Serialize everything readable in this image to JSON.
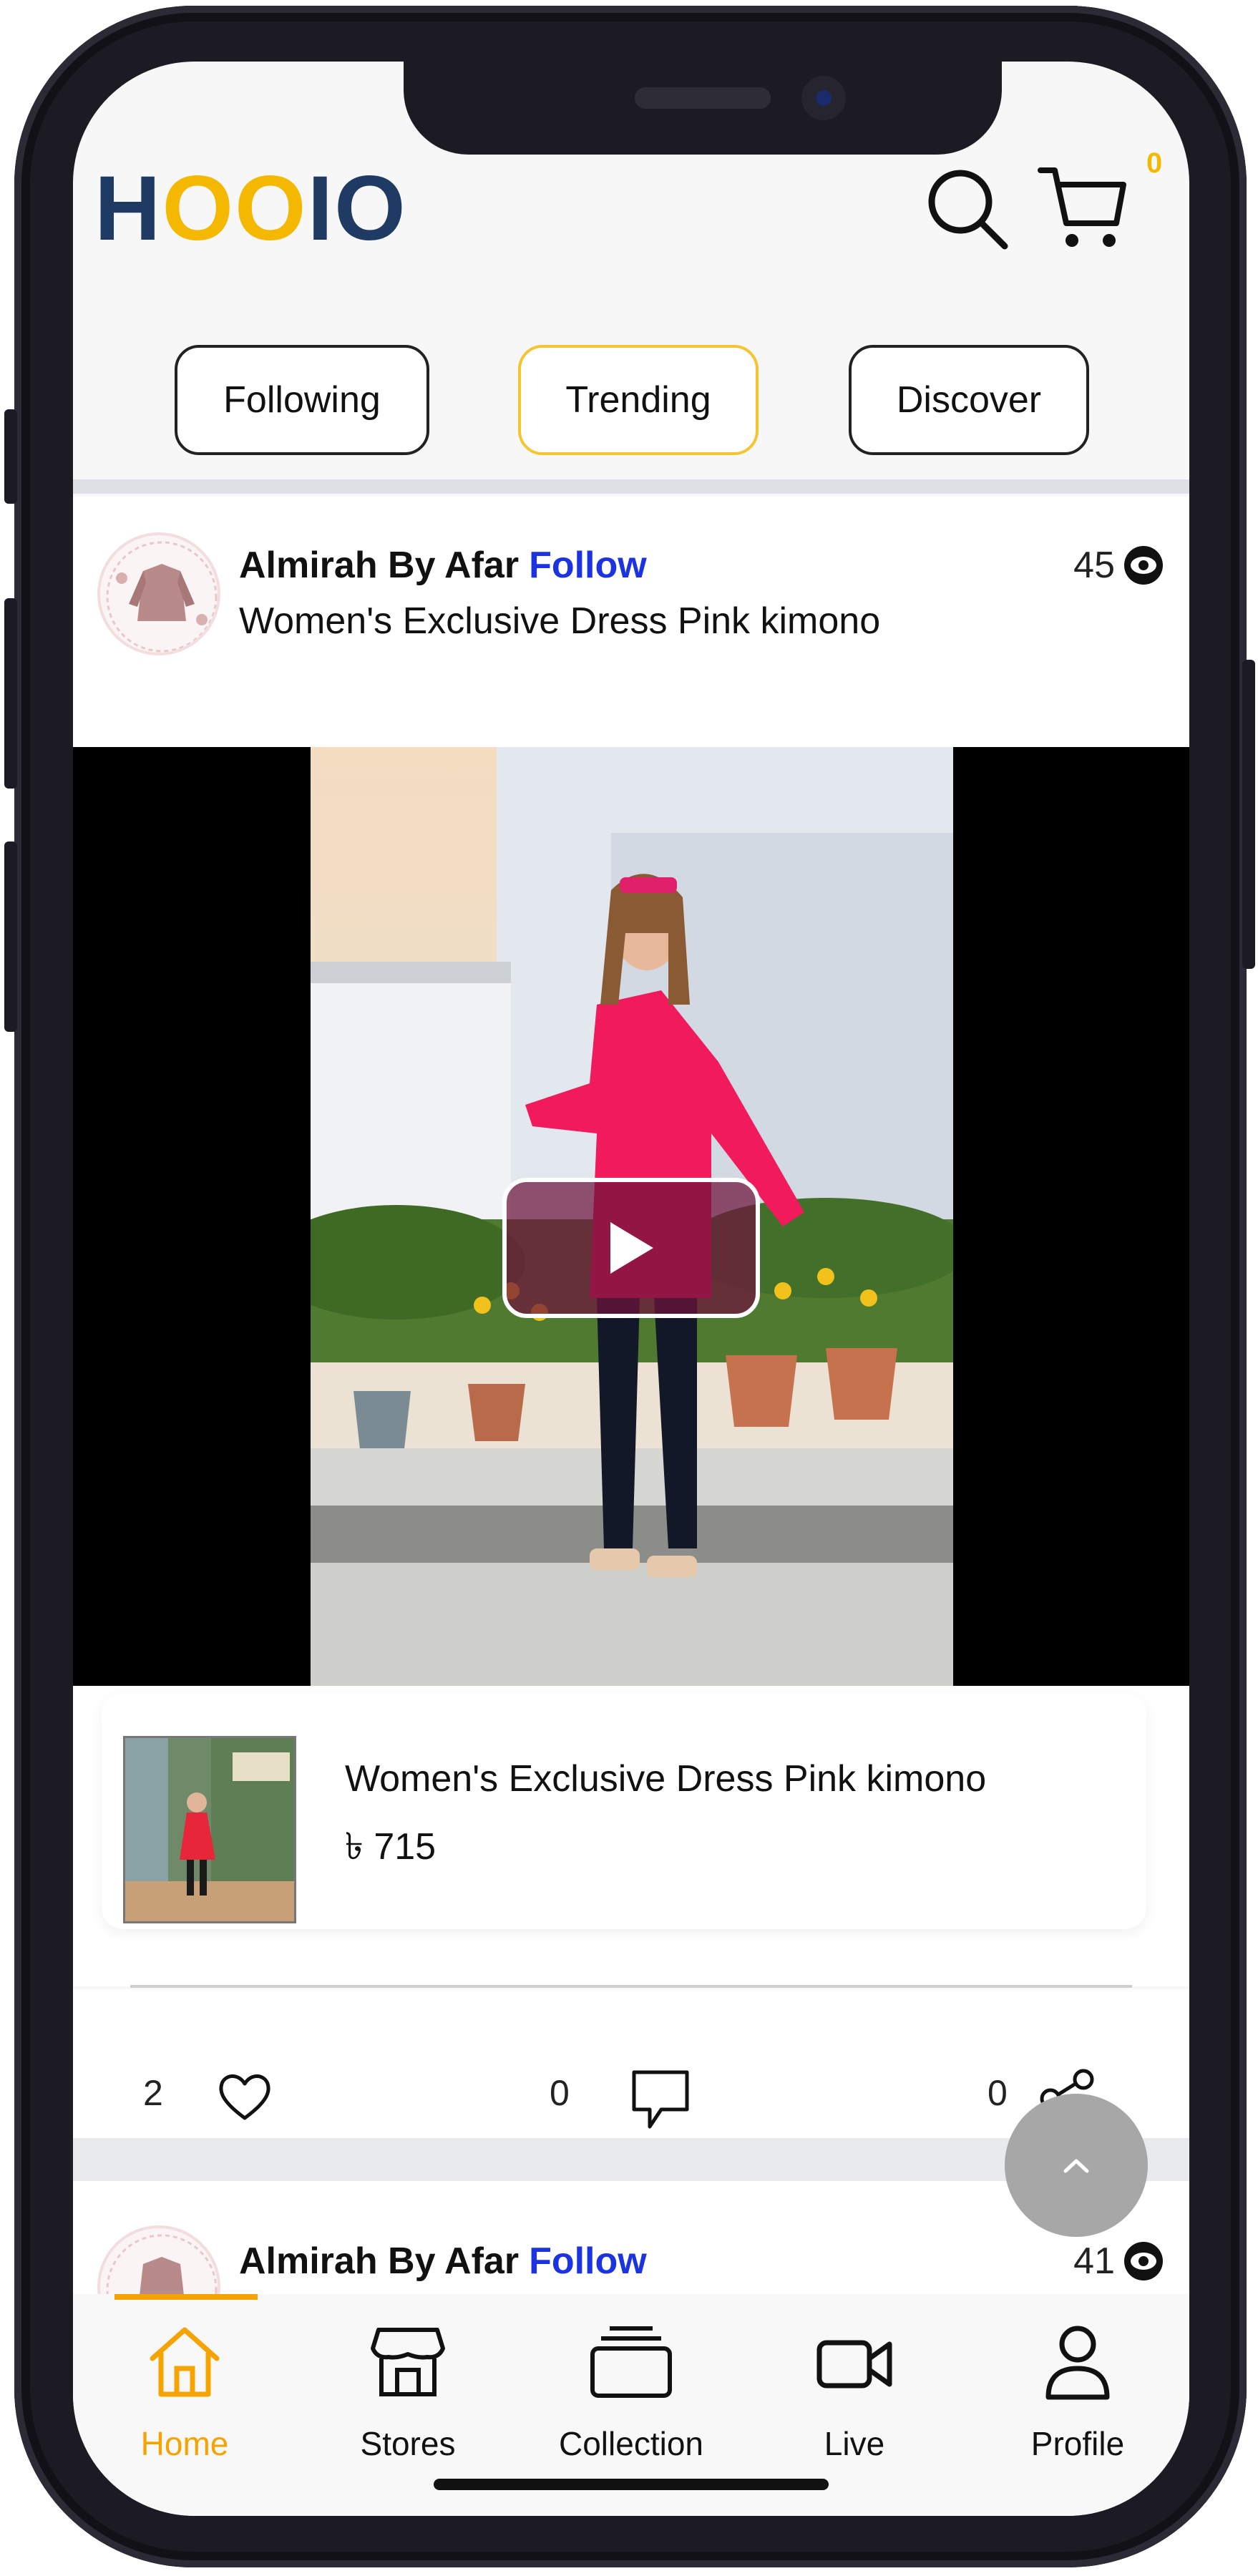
{
  "header": {
    "logo": {
      "part1": "H",
      "part2": "O",
      "part3": "O",
      "part4": "IO"
    },
    "cart_count": "0"
  },
  "tabs": [
    {
      "label": "Following"
    },
    {
      "label": "Trending"
    },
    {
      "label": "Discover"
    }
  ],
  "post1": {
    "author": "Almirah By Afar",
    "follow_label": "Follow",
    "views": "45",
    "caption": "Women's Exclusive Dress Pink kimono",
    "product": {
      "title": "Women's Exclusive Dress Pink kimono",
      "price": "৳ 715"
    },
    "likes": "2",
    "comments": "0",
    "shares": "0"
  },
  "post2": {
    "author": "Almirah By Afar",
    "follow_label": "Follow",
    "views": "41"
  },
  "nav": [
    {
      "label": "Home",
      "icon": "home-icon"
    },
    {
      "label": "Stores",
      "icon": "store-icon"
    },
    {
      "label": "Collection",
      "icon": "collection-icon"
    },
    {
      "label": "Live",
      "icon": "video-camera-icon"
    },
    {
      "label": "Profile",
      "icon": "person-icon"
    }
  ],
  "colors": {
    "accent": "#f5a300",
    "brand_blue": "#1f3b63",
    "follow_blue": "#1b33e0",
    "active_tab_border": "#f5c431"
  }
}
